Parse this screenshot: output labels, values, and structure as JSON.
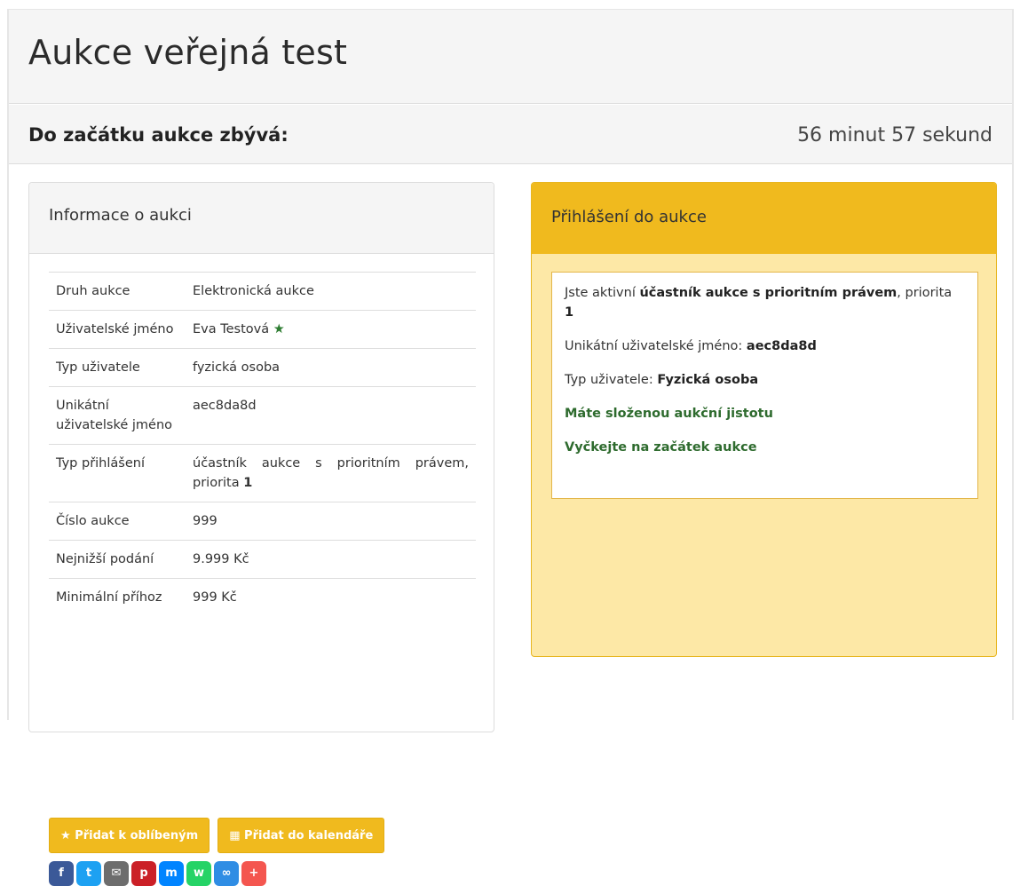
{
  "page": {
    "title": "Aukce veřejná test",
    "countdown_label": "Do začátku aukce zbývá:",
    "countdown_value": "56 minut 57 sekund"
  },
  "info_panel": {
    "heading": "Informace o aukci",
    "rows": [
      {
        "label": "Druh aukce",
        "value": "Elektronická aukce"
      },
      {
        "label": "Uživatelské jméno",
        "value": "Eva Testová"
      },
      {
        "label": "Typ uživatele",
        "value": "fyzická osoba"
      },
      {
        "label": "Unikátní uživatelské jméno",
        "value": "aec8da8d"
      },
      {
        "label": "Typ přihlášení",
        "value": "účastník aukce s prioritním právem, priorita",
        "value_bold": "1"
      },
      {
        "label": "Číslo aukce",
        "value": "999"
      },
      {
        "label": "Nejnižší podání",
        "value": "9.999 Kč"
      },
      {
        "label": "Minimální příhoz",
        "value": "999 Kč"
      }
    ],
    "buttons": {
      "favorite": "Přidat k oblíbeným",
      "calendar": "Přidat do kalendáře"
    },
    "share": [
      {
        "icon": "facebook-icon",
        "glyph": "f",
        "color": "#3b5998"
      },
      {
        "icon": "twitter-icon",
        "glyph": "t",
        "color": "#1da1f2"
      },
      {
        "icon": "email-icon",
        "glyph": "✉",
        "color": "#6d6d6d"
      },
      {
        "icon": "pinterest-icon",
        "glyph": "p",
        "color": "#cb2027"
      },
      {
        "icon": "messenger-icon",
        "glyph": "m",
        "color": "#0084ff"
      },
      {
        "icon": "whatsapp-icon",
        "glyph": "w",
        "color": "#25d366"
      },
      {
        "icon": "link-icon",
        "glyph": "∞",
        "color": "#2f8de4"
      },
      {
        "icon": "more-icon",
        "glyph": "+",
        "color": "#f4564f"
      }
    ]
  },
  "login_panel": {
    "heading": "Přihlášení do aukce",
    "status_prefix": "Jste aktivní",
    "status_role": "účastník aukce s prioritním právem",
    "status_suffix": ", priorita",
    "status_priority": "1",
    "unique_label": "Unikátní uživatelské jméno:",
    "unique_value": "aec8da8d",
    "type_label": "Typ uživatele:",
    "type_value": "Fyzická osoba",
    "deposit_text": "Máte složenou aukční jistotu",
    "wait_text": "Vyčkejte na začátek aukce"
  },
  "colors": {
    "accent_yellow": "#f0ba1e",
    "panel_yellow": "#fde8a6",
    "success_green": "#2e6b2e",
    "star_green": "#2e7d32"
  }
}
